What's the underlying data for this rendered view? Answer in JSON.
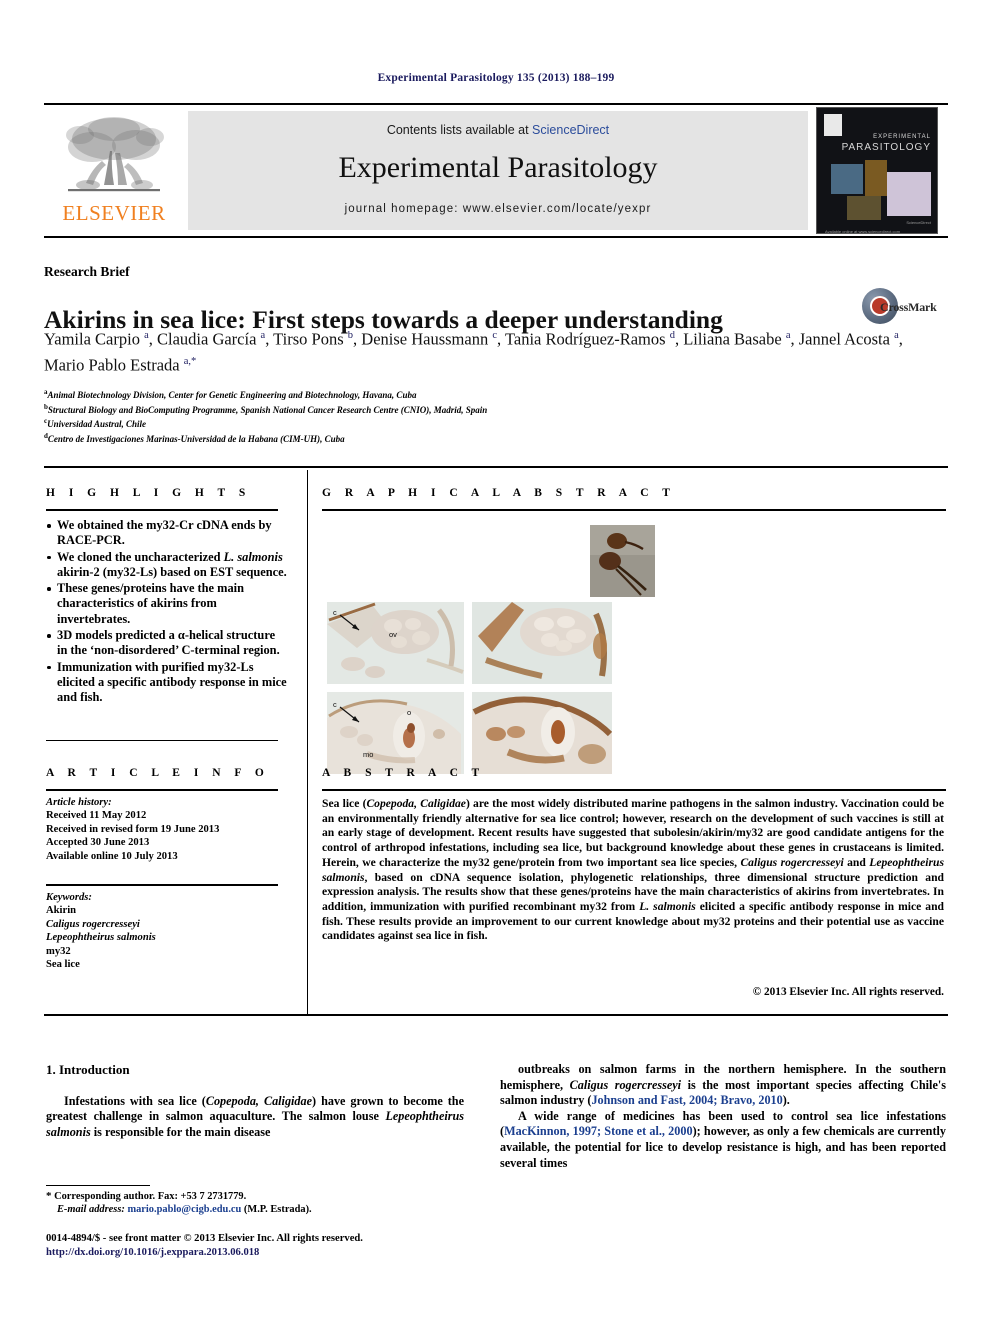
{
  "running_head": "Experimental Parasitology 135 (2013) 188–199",
  "masthead": {
    "contents_prefix": "Contents lists available at ",
    "sciencedirect": "ScienceDirect",
    "journal_name": "Experimental Parasitology",
    "homepage": "journal homepage: www.elsevier.com/locate/yexpr",
    "publisher_logo_text": "ELSEVIER",
    "cover": {
      "title_line1": "EXPERIMENTAL",
      "title_line2": "PARASITOLOGY",
      "foot_left": "Available online at www.sciencedirect.com",
      "foot_right": "ScienceDirect"
    }
  },
  "article": {
    "doc_type": "Research Brief",
    "title": "Akirins in sea lice: First steps towards a deeper understanding",
    "crossmark_label": "CrossMark",
    "authors_html": "Yamila Carpio <sup>a</sup>, Claudia García <sup>a</sup>, Tirso Pons <sup>b</sup>, Denise Haussmann <sup>c</sup>, Tania Rodríguez-Ramos <sup>d</sup>, Liliana Basabe <sup>a</sup>, Jannel Acosta <sup>a</sup>, Mario Pablo Estrada <sup>a,*</sup>",
    "affiliations": [
      {
        "mark": "a",
        "text": "Animal Biotechnology Division, Center for Genetic Engineering and Biotechnology, Havana, Cuba"
      },
      {
        "mark": "b",
        "text": "Structural Biology and BioComputing Programme, Spanish National Cancer Research Centre (CNIO), Madrid, Spain"
      },
      {
        "mark": "c",
        "text": "Universidad Austral, Chile"
      },
      {
        "mark": "d",
        "text": "Centro de Investigaciones Marinas-Universidad de la Habana (CIM-UH), Cuba"
      }
    ]
  },
  "highlights": {
    "heading": "H I G H L I G H T S",
    "items": [
      "We obtained the my32-Cr cDNA ends by RACE-PCR.",
      "We cloned the uncharacterized <i>L. salmonis</i> akirin-2 (my32-Ls) based on EST sequence.",
      "These genes/proteins have the main characteristics of akirins from invertebrates.",
      "3D models predicted a α-helical structure in the ‘non-disordered’ C-terminal region.",
      "Immunization with purified my32-Ls elicited a specific antibody response in mice and fish."
    ]
  },
  "article_info": {
    "heading": "A R T I C L E    I N F O",
    "history_label": "Article history:",
    "history": [
      "Received 11 May 2012",
      "Received in revised form 19 June 2013",
      "Accepted 30 June 2013",
      "Available online 10 July 2013"
    ],
    "keywords_label": "Keywords:",
    "keywords": [
      {
        "text": "Akirin",
        "italic": false
      },
      {
        "text": "Caligus rogercresseyi",
        "italic": true
      },
      {
        "text": "Lepeophtheirus salmonis",
        "italic": true
      },
      {
        "text": "my32",
        "italic": false
      },
      {
        "text": "Sea lice",
        "italic": false
      }
    ]
  },
  "graphical_abstract": {
    "heading": "G R A P H I C A L   A B S T R A C T",
    "panel_labels": [
      "c",
      "ov",
      "c",
      "o",
      "mo"
    ]
  },
  "abstract": {
    "heading": "A B S T R A C T",
    "text_html": "Sea lice (<i>Copepoda, Caligidae</i>) are the most widely distributed marine pathogens in the salmon industry. Vaccination could be an environmentally friendly alternative for sea lice control; however, research on the development of such vaccines is still at an early stage of development. Recent results have suggested that subolesin/akirin/my32 are good candidate antigens for the control of arthropod infestations, including sea lice, but background knowledge about these genes in crustaceans is limited. Herein, we characterize the my32 gene/protein from two important sea lice species, <i>Caligus rogercresseyi</i> and <i>Lepeophtheirus salmonis</i>, based on cDNA sequence isolation, phylogenetic relationships, three dimensional structure prediction and expression analysis. The results show that these genes/proteins have the main characteristics of akirins from invertebrates. In addition, immunization with purified recombinant my32 from <i>L. salmonis</i> elicited a specific antibody response in mice and fish. These results provide an improvement to our current knowledge about my32 proteins and their potential use as vaccine candidates against sea lice in fish.",
    "copyright": "© 2013 Elsevier Inc. All rights reserved."
  },
  "body": {
    "section_number_title": "1. Introduction",
    "left_paragraph_html": "Infestations with sea lice (<i>Copepoda, Caligidae</i>) have grown to become the greatest challenge in salmon aquaculture. The salmon louse <i>Lepeophtheirus salmonis</i> is responsible for the main disease",
    "right_paragraph1_html": "outbreaks on salmon farms in the northern hemisphere. In the southern hemisphere, <i>Caligus rogercresseyi</i> is the most important species affecting Chile's salmon industry (<span class=\"cite\">Johnson and Fast, 2004; Bravo, 2010</span>).",
    "right_paragraph2_html": "A wide range of medicines has been used to control sea lice infestations (<span class=\"cite\">MacKinnon, 1997; Stone et al., 2000</span>); however, as only a few chemicals are currently available, the potential for lice to develop resistance is high, and has been reported several times"
  },
  "footnote": {
    "corresponding_html": "<span class=\"star\">*</span> Corresponding author. Fax: +53 7 2731779.",
    "email_html": "<span class=\"ital\">E-mail address:</span> <span class=\"mail-link\">mario.pablo@cigb.edu.cu</span> (M.P. Estrada)."
  },
  "imprint": {
    "line1": "0014-4894/$ - see front matter © 2013 Elsevier Inc. All rights reserved.",
    "line2": "http://dx.doi.org/10.1016/j.exppara.2013.06.018"
  }
}
